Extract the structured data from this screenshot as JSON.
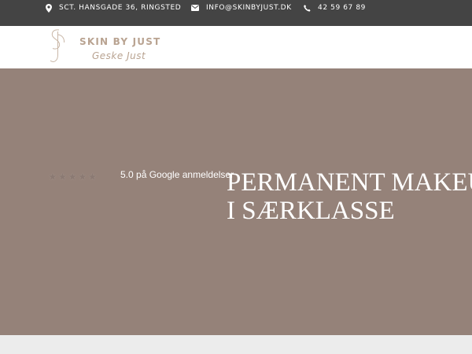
{
  "topbar": {
    "address": "SCT. HANSGADE 36, RINGSTED",
    "email": "INFO@SKINBYJUST.DK",
    "phone": "42 59 67 89",
    "address_icon": "map-pin-icon",
    "email_icon": "envelope-icon",
    "phone_icon": "phone-icon"
  },
  "header": {
    "logo_monogram": "SJ",
    "logo_name": "SKIN BY JUST",
    "logo_subtitle": "Geske Just"
  },
  "hero": {
    "rating_stars": 5,
    "rating_text": "5.0 på Google anmeldelser",
    "title_line1": "PERMANENT MAKEUP",
    "title_line2": "I SÆRKLASSE"
  },
  "colors": {
    "topbar_bg": "#444444",
    "hero_bg": "#958279",
    "brand_accent": "#b9a391",
    "bottom_strip": "#ececec"
  }
}
